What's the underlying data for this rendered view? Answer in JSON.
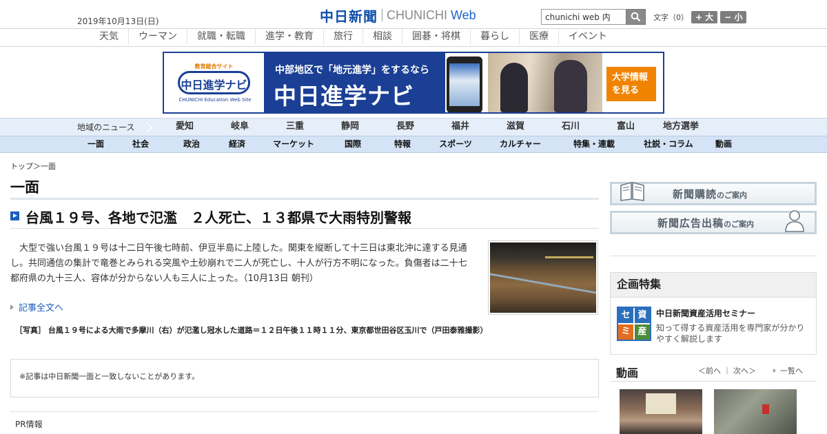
{
  "header": {
    "date": "2019年10月13日(日)",
    "logo_main": "中日新聞",
    "logo_sub": "CHUNICHI",
    "logo_web": "Web",
    "search_value": "chunichi web 内",
    "font_label": "文字（0）",
    "font_larger": "+ 大",
    "font_smaller": "− 小"
  },
  "topnav": [
    "天気",
    "ウーマン",
    "就職・転職",
    "進学・教育",
    "旅行",
    "相談",
    "囲碁・将棋",
    "暮らし",
    "医療",
    "イベント"
  ],
  "banner": {
    "logo_small": "教育総合サイト",
    "logo_pill": "中日進学ナビ",
    "logo_en": "CHUNICHI Education Web Site",
    "line1": "中部地区で「地元進学」をするなら",
    "line2": "中日進学ナビ",
    "cta1": "大学情報",
    "cta2": "を見る"
  },
  "areanav": {
    "label": "地域のニュース",
    "items": [
      "愛知",
      "岐阜",
      "三重",
      "静岡",
      "長野",
      "福井",
      "滋賀",
      "石川",
      "富山",
      "地方選挙"
    ]
  },
  "mainnav": [
    "一面",
    "社会",
    "政治",
    "経済",
    "マーケット",
    "国際",
    "特報",
    "スポーツ",
    "カルチャー",
    "特集・連載",
    "社説・コラム",
    "動画"
  ],
  "breadcrumb": "トップ＞一面",
  "section_title": "一面",
  "article": {
    "headline": "台風１９号、各地で氾濫　２人死亡、１３都県で大雨特別警報",
    "body": "大型で強い台風１９号は十二日午後七時前、伊豆半島に上陸した。関東を縦断して十三日は東北沖に達する見通し。共同通信の集計で竜巻とみられる突風や土砂崩れで二人が死亡し、十人が行方不明になった。負傷者は二十七都府県の九十三人、容体が分からない人も三人に上った。（10月13日 朝刊）",
    "read_more": "記事全文へ",
    "caption": "［写真］ 台風１９号による大雨で多摩川（右）が氾濫し冠水した道路＝１２日午後１１時１１分、東京都世田谷区玉川で（戸田泰雅撮影）"
  },
  "notice": "※記事は中日新聞一面と一致しないことがあります。",
  "pr_label": "PR情報",
  "sidebar": {
    "subscribe_main": "新聞購読",
    "subscribe_suffix": "のご案内",
    "ad_main": "新聞広告出稿",
    "ad_suffix": "のご案内",
    "kikaku_heading": "企画特集",
    "kikaku_thumb": [
      "セ",
      "資",
      "ミ",
      "産"
    ],
    "kikaku_title": "中日新聞資産活用セミナー",
    "kikaku_desc": "知って得する資産活用を専門家が分かりやすく解説します",
    "video_heading": "動画",
    "video_prev": "＜前へ",
    "video_next": "次へ＞",
    "video_list": "一覧へ"
  }
}
